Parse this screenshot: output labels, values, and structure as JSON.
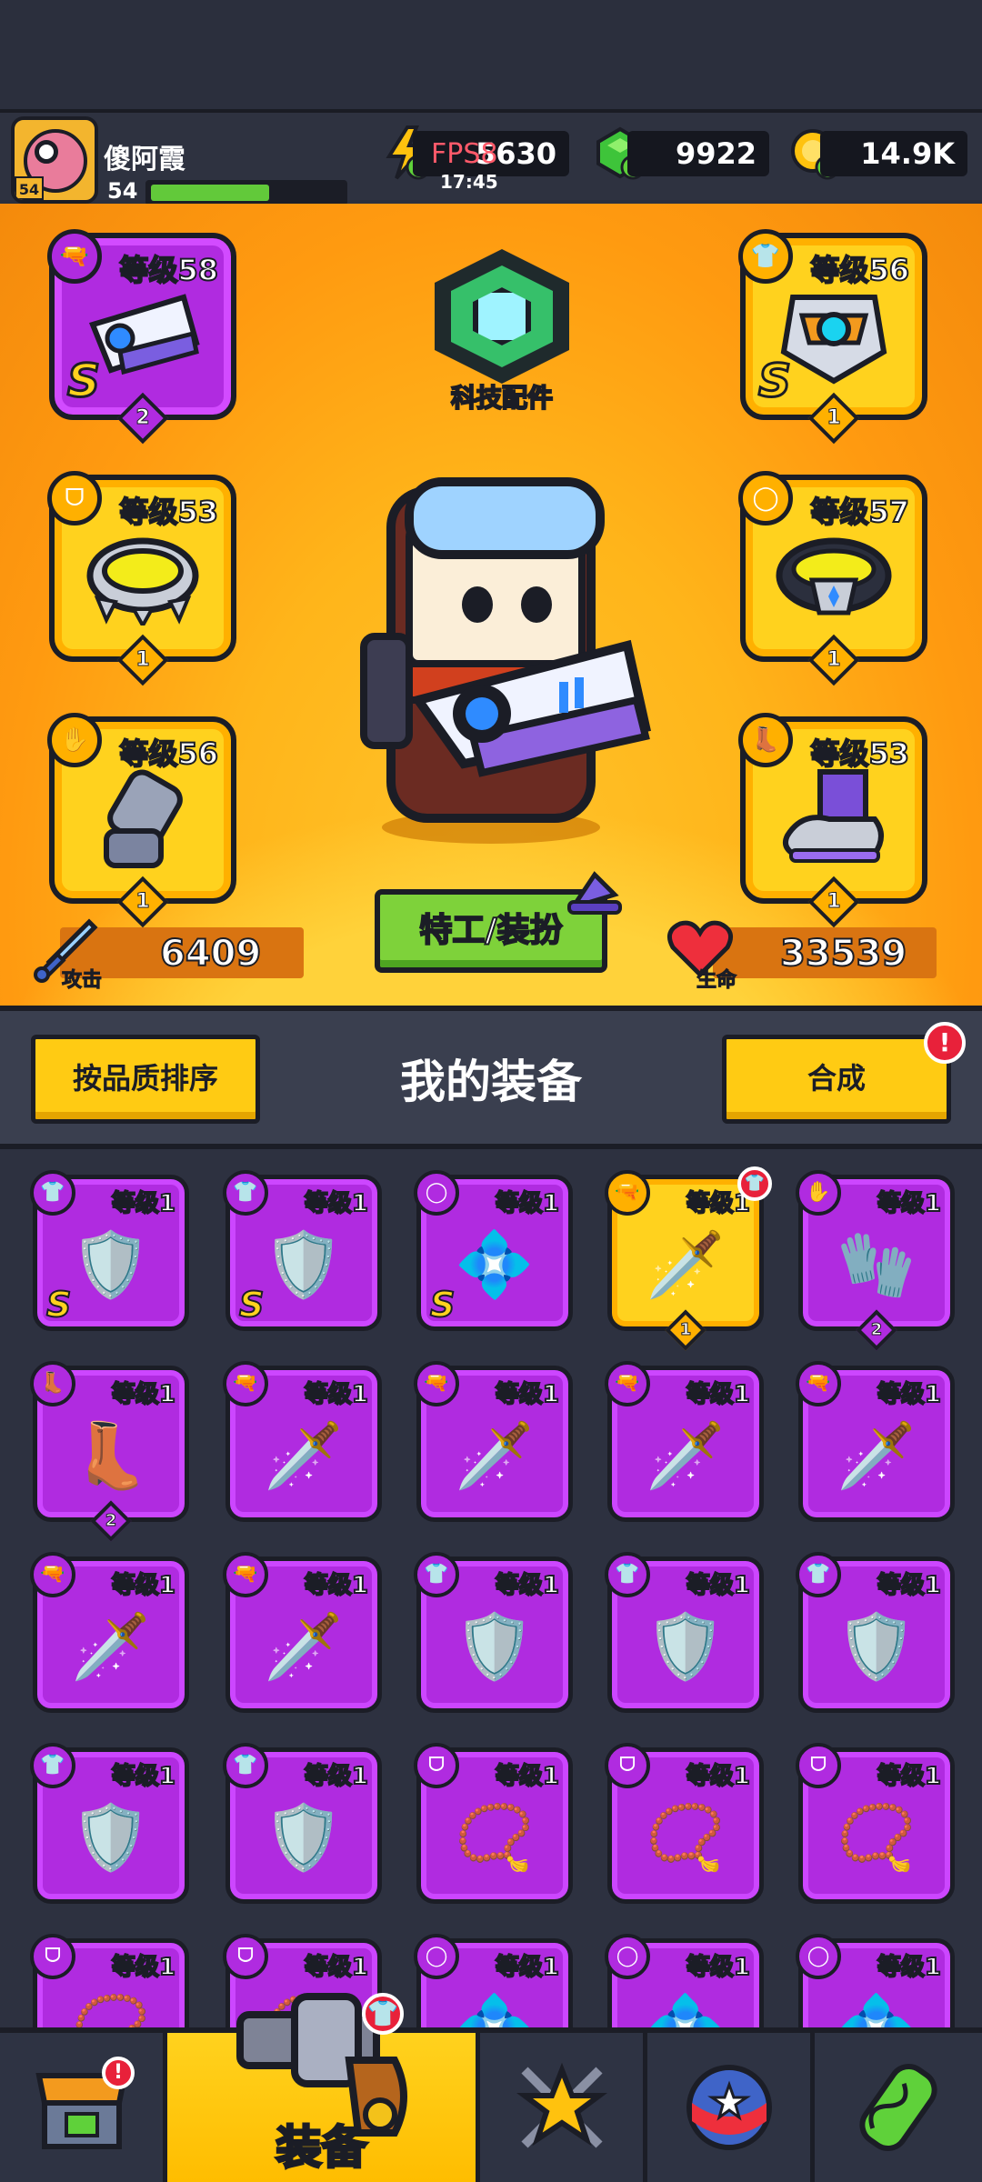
{
  "header": {
    "player_name": "傻阿霞",
    "player_level": "54",
    "avatar_level": "54",
    "xp_fraction": 0.62,
    "energy": "5630",
    "fps_overlay": "FPS8",
    "time": "17:45",
    "gems": "9922",
    "coins": "14.9K"
  },
  "hero": {
    "tech_label": "科技配件",
    "agent_button": "特工/装扮",
    "attack_label": "攻击",
    "attack_value": "6409",
    "health_label": "生命",
    "health_value": "33539",
    "slots": [
      {
        "level": "等级58",
        "type": "weapon",
        "grade": "S",
        "stars": "2",
        "rarity": "purple"
      },
      {
        "level": "等级53",
        "type": "necklace",
        "grade": "",
        "stars": "1",
        "rarity": "gold"
      },
      {
        "level": "等级56",
        "type": "glove",
        "grade": "",
        "stars": "1",
        "rarity": "gold"
      },
      {
        "level": "等级56",
        "type": "armor",
        "grade": "S",
        "stars": "1",
        "rarity": "gold"
      },
      {
        "level": "等级57",
        "type": "belt",
        "grade": "",
        "stars": "1",
        "rarity": "gold"
      },
      {
        "level": "等级53",
        "type": "boots",
        "grade": "",
        "stars": "1",
        "rarity": "gold"
      }
    ]
  },
  "section": {
    "sort_button": "按品质排序",
    "title": "我的装备",
    "merge_button": "合成",
    "merge_badge": "!"
  },
  "inventory": [
    {
      "level": "等级1",
      "grade": "S",
      "stars": "",
      "rarity": "purple",
      "type": "armor"
    },
    {
      "level": "等级1",
      "grade": "S",
      "stars": "",
      "rarity": "purple",
      "type": "armor"
    },
    {
      "level": "等级1",
      "grade": "S",
      "stars": "",
      "rarity": "purple",
      "type": "belt"
    },
    {
      "level": "等级1",
      "grade": "",
      "stars": "1",
      "rarity": "gold",
      "type": "weapon"
    },
    {
      "level": "等级1",
      "grade": "",
      "stars": "2",
      "rarity": "purple",
      "type": "glove"
    },
    {
      "level": "等级1",
      "grade": "",
      "stars": "2",
      "rarity": "purple",
      "type": "boots"
    },
    {
      "level": "等级1",
      "grade": "",
      "stars": "",
      "rarity": "purple",
      "type": "weapon"
    },
    {
      "level": "等级1",
      "grade": "",
      "stars": "",
      "rarity": "purple",
      "type": "weapon"
    },
    {
      "level": "等级1",
      "grade": "",
      "stars": "",
      "rarity": "purple",
      "type": "weapon"
    },
    {
      "level": "等级1",
      "grade": "",
      "stars": "",
      "rarity": "purple",
      "type": "weapon"
    },
    {
      "level": "等级1",
      "grade": "",
      "stars": "",
      "rarity": "purple",
      "type": "weapon"
    },
    {
      "level": "等级1",
      "grade": "",
      "stars": "",
      "rarity": "purple",
      "type": "weapon"
    },
    {
      "level": "等级1",
      "grade": "",
      "stars": "",
      "rarity": "purple",
      "type": "armor"
    },
    {
      "level": "等级1",
      "grade": "",
      "stars": "",
      "rarity": "purple",
      "type": "armor"
    },
    {
      "level": "等级1",
      "grade": "",
      "stars": "",
      "rarity": "purple",
      "type": "armor"
    },
    {
      "level": "等级1",
      "grade": "",
      "stars": "",
      "rarity": "purple",
      "type": "armor"
    },
    {
      "level": "等级1",
      "grade": "",
      "stars": "",
      "rarity": "purple",
      "type": "armor"
    },
    {
      "level": "等级1",
      "grade": "",
      "stars": "",
      "rarity": "purple",
      "type": "necklace"
    },
    {
      "level": "等级1",
      "grade": "",
      "stars": "",
      "rarity": "purple",
      "type": "necklace"
    },
    {
      "level": "等级1",
      "grade": "",
      "stars": "",
      "rarity": "purple",
      "type": "necklace"
    },
    {
      "level": "等级1",
      "grade": "",
      "stars": "",
      "rarity": "purple",
      "type": "necklace"
    },
    {
      "level": "等级1",
      "grade": "",
      "stars": "",
      "rarity": "purple",
      "type": "necklace"
    },
    {
      "level": "等级1",
      "grade": "",
      "stars": "",
      "rarity": "purple",
      "type": "belt"
    },
    {
      "level": "等级1",
      "grade": "",
      "stars": "",
      "rarity": "purple",
      "type": "belt"
    },
    {
      "level": "等级1",
      "grade": "",
      "stars": "",
      "rarity": "purple",
      "type": "belt"
    }
  ],
  "bottom_nav": {
    "active_label": "装备",
    "shop_badge": "!"
  },
  "colors": {
    "purple": "#b02be0",
    "gold": "#ffd21e",
    "orange_bg": "#ff9a10",
    "green": "#7ed23a"
  }
}
